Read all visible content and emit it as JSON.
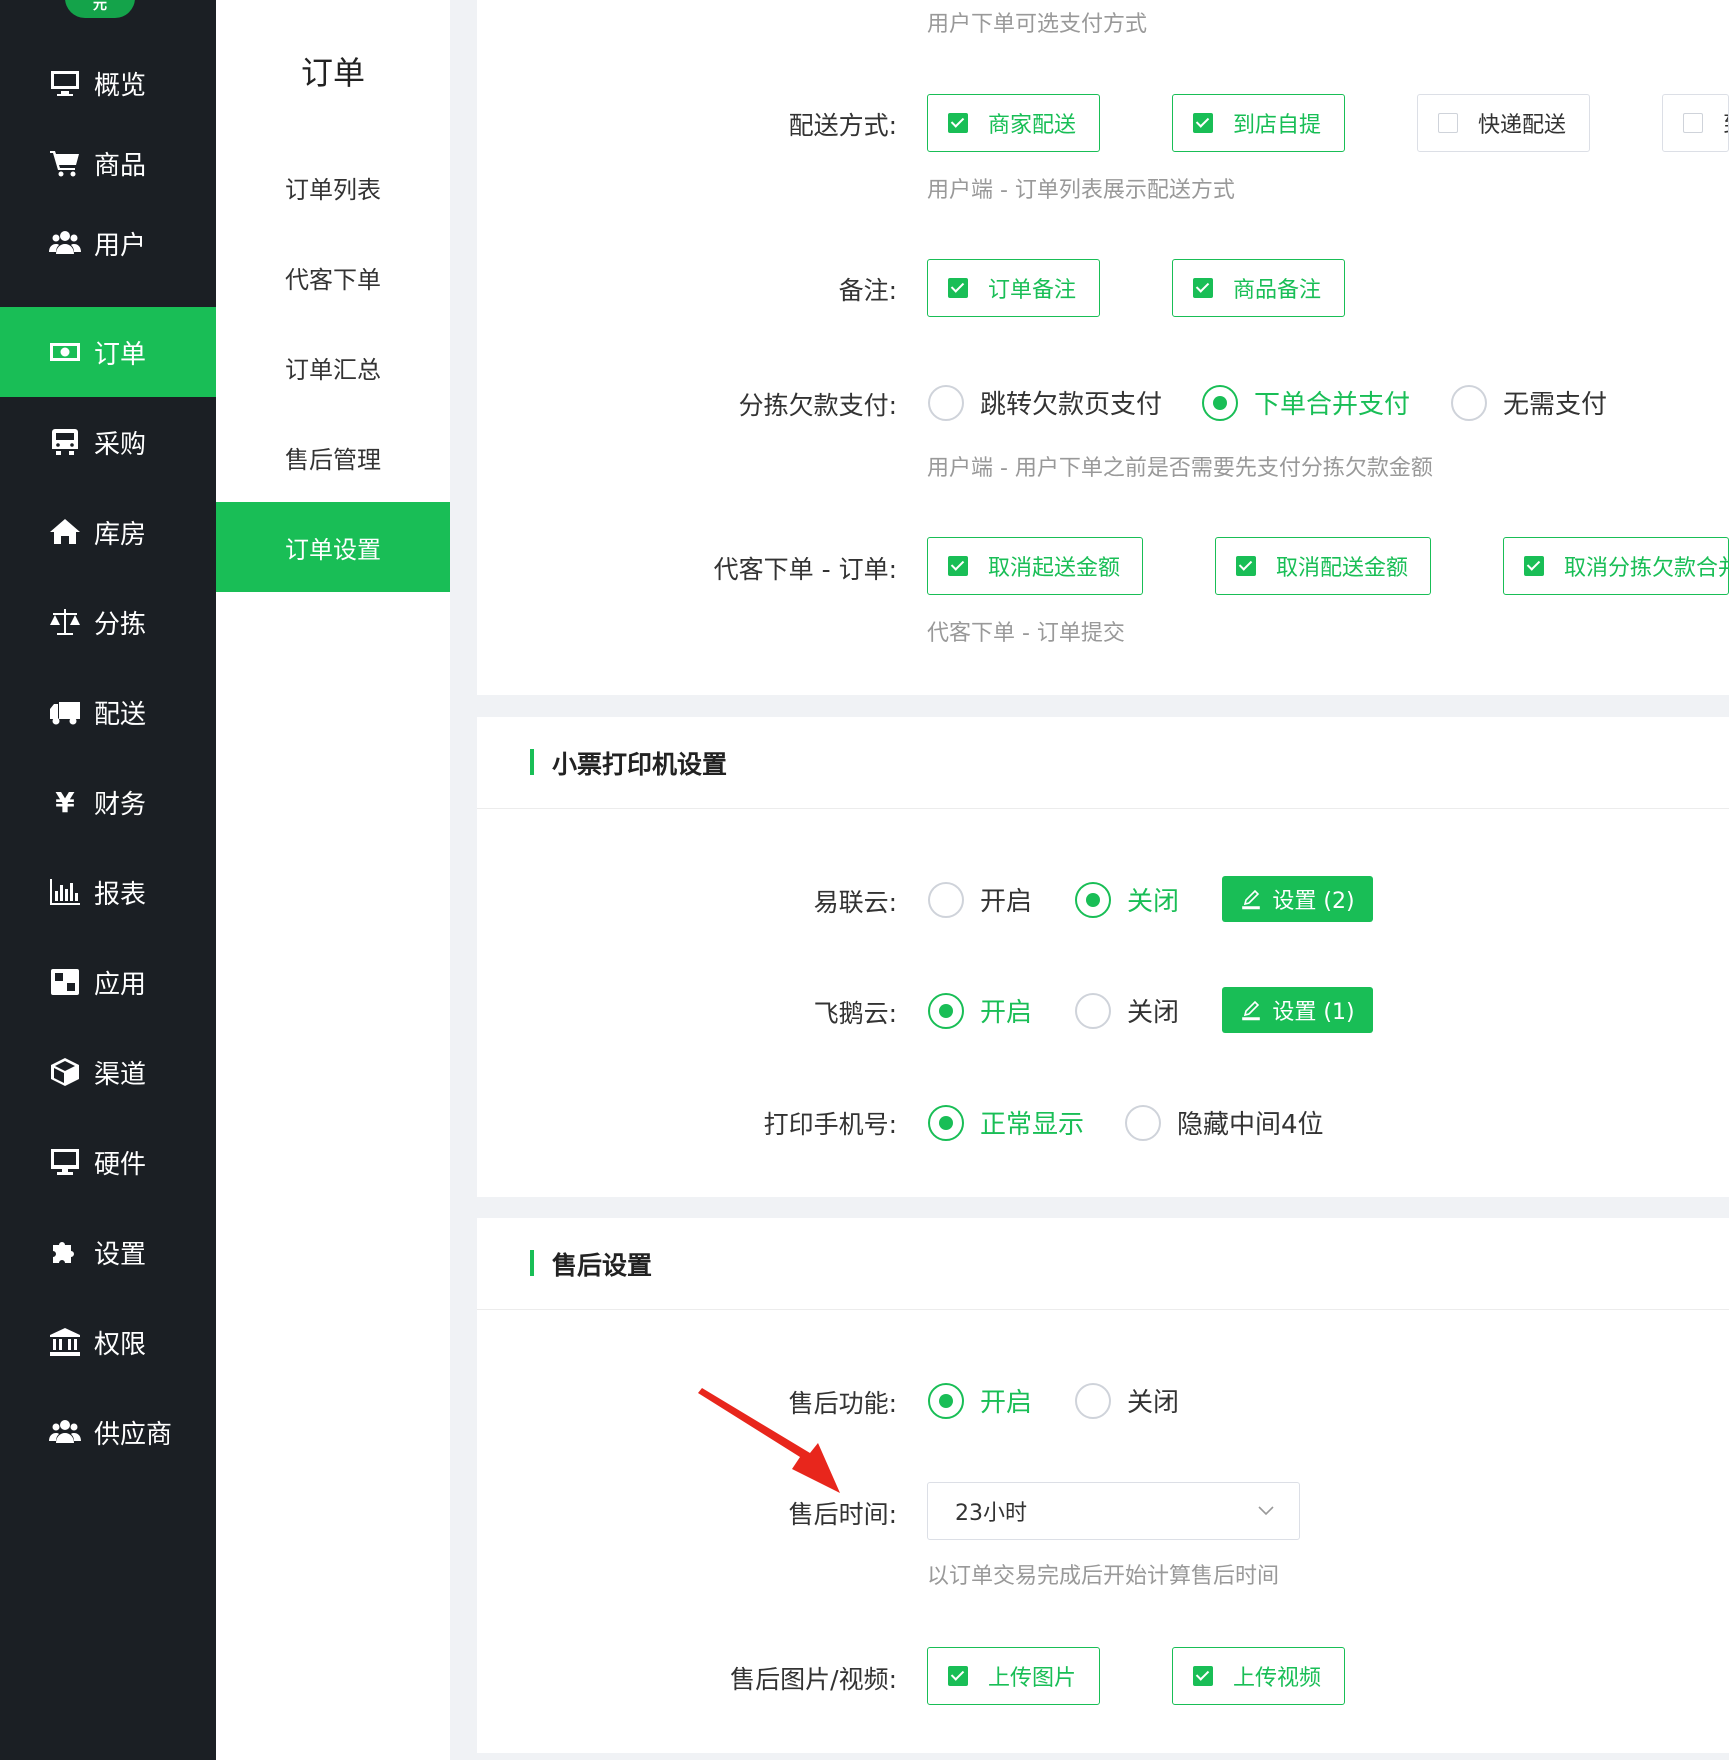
{
  "nav": {
    "logo": "元",
    "items": [
      {
        "label": "概览",
        "icon": "monitor-icon"
      },
      {
        "label": "商品",
        "icon": "cart-icon"
      },
      {
        "label": "用户",
        "icon": "users-icon"
      },
      {
        "label": "订单",
        "icon": "money-icon"
      },
      {
        "label": "采购",
        "icon": "bus-icon"
      },
      {
        "label": "库房",
        "icon": "home-icon"
      },
      {
        "label": "分拣",
        "icon": "scale-icon"
      },
      {
        "label": "配送",
        "icon": "truck-icon"
      },
      {
        "label": "财务",
        "icon": "yen-icon"
      },
      {
        "label": "报表",
        "icon": "bar-chart-icon"
      },
      {
        "label": "应用",
        "icon": "apps-icon"
      },
      {
        "label": "渠道",
        "icon": "cube-icon"
      },
      {
        "label": "硬件",
        "icon": "desktop-icon"
      },
      {
        "label": "设置",
        "icon": "puzzle-icon"
      },
      {
        "label": "权限",
        "icon": "bank-icon"
      },
      {
        "label": "供应商",
        "icon": "users-icon"
      }
    ]
  },
  "subnav": {
    "title": "订单",
    "items": [
      "订单列表",
      "代客下单",
      "订单汇总",
      "售后管理",
      "订单设置"
    ]
  },
  "order_settings": {
    "pay_hint": "用户下单可选支付方式",
    "delivery": {
      "label": "配送方式:",
      "options": [
        "商家配送",
        "到店自提",
        "快递配送",
        "到"
      ],
      "hint": "用户端 - 订单列表展示配送方式"
    },
    "remark": {
      "label": "备注:",
      "options": [
        "订单备注",
        "商品备注"
      ]
    },
    "sorting_debt": {
      "label": "分拣欠款支付:",
      "options": [
        "跳转欠款页支付",
        "下单合并支付",
        "无需支付"
      ],
      "hint": "用户端 - 用户下单之前是否需要先支付分拣欠款金额"
    },
    "proxy_order": {
      "label": "代客下单 - 订单:",
      "options": [
        "取消起送金额",
        "取消配送金额",
        "取消分拣欠款合并"
      ],
      "hint": "代客下单 - 订单提交"
    }
  },
  "printer": {
    "title": "小票打印机设置",
    "yilianyun": {
      "label": "易联云:",
      "on": "开启",
      "off": "关闭",
      "button": "设置 (2)"
    },
    "feieyun": {
      "label": "飞鹅云:",
      "on": "开启",
      "off": "关闭",
      "button": "设置 (1)"
    },
    "phone": {
      "label": "打印手机号:",
      "normal": "正常显示",
      "hidden": "隐藏中间4位"
    }
  },
  "after_sale": {
    "title": "售后设置",
    "function": {
      "label": "售后功能:",
      "on": "开启",
      "off": "关闭"
    },
    "time": {
      "label": "售后时间:",
      "value": "23小时",
      "hint": "以订单交易完成后开始计算售后时间"
    },
    "media": {
      "label": "售后图片/视频:",
      "options": [
        "上传图片",
        "上传视频"
      ]
    }
  },
  "colors": {
    "accent": "#19be56",
    "nav_bg": "#1b1f24",
    "annotation": "#e8261c"
  }
}
